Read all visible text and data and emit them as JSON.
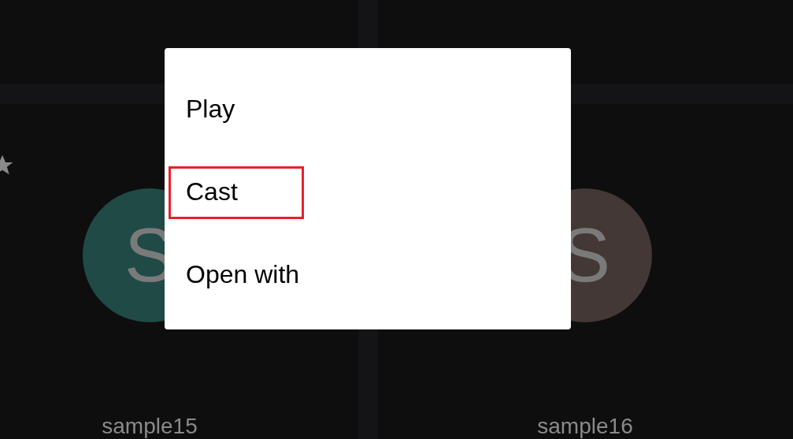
{
  "tiles": [
    {
      "letter": "S",
      "color": "#204a45",
      "name": "sample15",
      "starred": true
    },
    {
      "letter": "S",
      "color": "#433835",
      "name": "sample16",
      "starred": false
    }
  ],
  "menu": {
    "items": [
      {
        "label": "Play",
        "highlighted": false
      },
      {
        "label": "Cast",
        "highlighted": true
      },
      {
        "label": "Open with",
        "highlighted": false
      }
    ]
  }
}
